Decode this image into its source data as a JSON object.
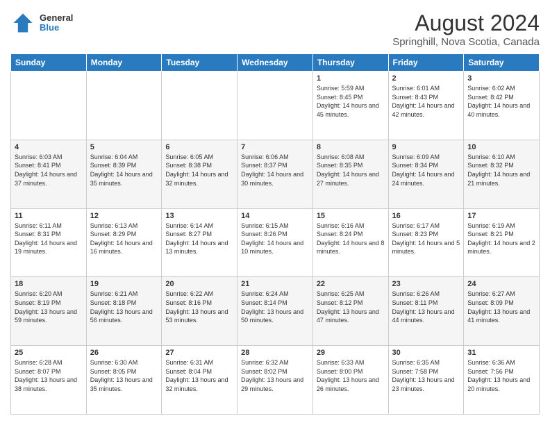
{
  "logo": {
    "line1": "General",
    "line2": "Blue"
  },
  "title": "August 2024",
  "location": "Springhill, Nova Scotia, Canada",
  "days_of_week": [
    "Sunday",
    "Monday",
    "Tuesday",
    "Wednesday",
    "Thursday",
    "Friday",
    "Saturday"
  ],
  "weeks": [
    [
      {
        "day": "",
        "content": ""
      },
      {
        "day": "",
        "content": ""
      },
      {
        "day": "",
        "content": ""
      },
      {
        "day": "",
        "content": ""
      },
      {
        "day": "1",
        "content": "Sunrise: 5:59 AM\nSunset: 8:45 PM\nDaylight: 14 hours and 45 minutes."
      },
      {
        "day": "2",
        "content": "Sunrise: 6:01 AM\nSunset: 8:43 PM\nDaylight: 14 hours and 42 minutes."
      },
      {
        "day": "3",
        "content": "Sunrise: 6:02 AM\nSunset: 8:42 PM\nDaylight: 14 hours and 40 minutes."
      }
    ],
    [
      {
        "day": "4",
        "content": "Sunrise: 6:03 AM\nSunset: 8:41 PM\nDaylight: 14 hours and 37 minutes."
      },
      {
        "day": "5",
        "content": "Sunrise: 6:04 AM\nSunset: 8:39 PM\nDaylight: 14 hours and 35 minutes."
      },
      {
        "day": "6",
        "content": "Sunrise: 6:05 AM\nSunset: 8:38 PM\nDaylight: 14 hours and 32 minutes."
      },
      {
        "day": "7",
        "content": "Sunrise: 6:06 AM\nSunset: 8:37 PM\nDaylight: 14 hours and 30 minutes."
      },
      {
        "day": "8",
        "content": "Sunrise: 6:08 AM\nSunset: 8:35 PM\nDaylight: 14 hours and 27 minutes."
      },
      {
        "day": "9",
        "content": "Sunrise: 6:09 AM\nSunset: 8:34 PM\nDaylight: 14 hours and 24 minutes."
      },
      {
        "day": "10",
        "content": "Sunrise: 6:10 AM\nSunset: 8:32 PM\nDaylight: 14 hours and 21 minutes."
      }
    ],
    [
      {
        "day": "11",
        "content": "Sunrise: 6:11 AM\nSunset: 8:31 PM\nDaylight: 14 hours and 19 minutes."
      },
      {
        "day": "12",
        "content": "Sunrise: 6:13 AM\nSunset: 8:29 PM\nDaylight: 14 hours and 16 minutes."
      },
      {
        "day": "13",
        "content": "Sunrise: 6:14 AM\nSunset: 8:27 PM\nDaylight: 14 hours and 13 minutes."
      },
      {
        "day": "14",
        "content": "Sunrise: 6:15 AM\nSunset: 8:26 PM\nDaylight: 14 hours and 10 minutes."
      },
      {
        "day": "15",
        "content": "Sunrise: 6:16 AM\nSunset: 8:24 PM\nDaylight: 14 hours and 8 minutes."
      },
      {
        "day": "16",
        "content": "Sunrise: 6:17 AM\nSunset: 8:23 PM\nDaylight: 14 hours and 5 minutes."
      },
      {
        "day": "17",
        "content": "Sunrise: 6:19 AM\nSunset: 8:21 PM\nDaylight: 14 hours and 2 minutes."
      }
    ],
    [
      {
        "day": "18",
        "content": "Sunrise: 6:20 AM\nSunset: 8:19 PM\nDaylight: 13 hours and 59 minutes."
      },
      {
        "day": "19",
        "content": "Sunrise: 6:21 AM\nSunset: 8:18 PM\nDaylight: 13 hours and 56 minutes."
      },
      {
        "day": "20",
        "content": "Sunrise: 6:22 AM\nSunset: 8:16 PM\nDaylight: 13 hours and 53 minutes."
      },
      {
        "day": "21",
        "content": "Sunrise: 6:24 AM\nSunset: 8:14 PM\nDaylight: 13 hours and 50 minutes."
      },
      {
        "day": "22",
        "content": "Sunrise: 6:25 AM\nSunset: 8:12 PM\nDaylight: 13 hours and 47 minutes."
      },
      {
        "day": "23",
        "content": "Sunrise: 6:26 AM\nSunset: 8:11 PM\nDaylight: 13 hours and 44 minutes."
      },
      {
        "day": "24",
        "content": "Sunrise: 6:27 AM\nSunset: 8:09 PM\nDaylight: 13 hours and 41 minutes."
      }
    ],
    [
      {
        "day": "25",
        "content": "Sunrise: 6:28 AM\nSunset: 8:07 PM\nDaylight: 13 hours and 38 minutes."
      },
      {
        "day": "26",
        "content": "Sunrise: 6:30 AM\nSunset: 8:05 PM\nDaylight: 13 hours and 35 minutes."
      },
      {
        "day": "27",
        "content": "Sunrise: 6:31 AM\nSunset: 8:04 PM\nDaylight: 13 hours and 32 minutes."
      },
      {
        "day": "28",
        "content": "Sunrise: 6:32 AM\nSunset: 8:02 PM\nDaylight: 13 hours and 29 minutes."
      },
      {
        "day": "29",
        "content": "Sunrise: 6:33 AM\nSunset: 8:00 PM\nDaylight: 13 hours and 26 minutes."
      },
      {
        "day": "30",
        "content": "Sunrise: 6:35 AM\nSunset: 7:58 PM\nDaylight: 13 hours and 23 minutes."
      },
      {
        "day": "31",
        "content": "Sunrise: 6:36 AM\nSunset: 7:56 PM\nDaylight: 13 hours and 20 minutes."
      }
    ]
  ]
}
